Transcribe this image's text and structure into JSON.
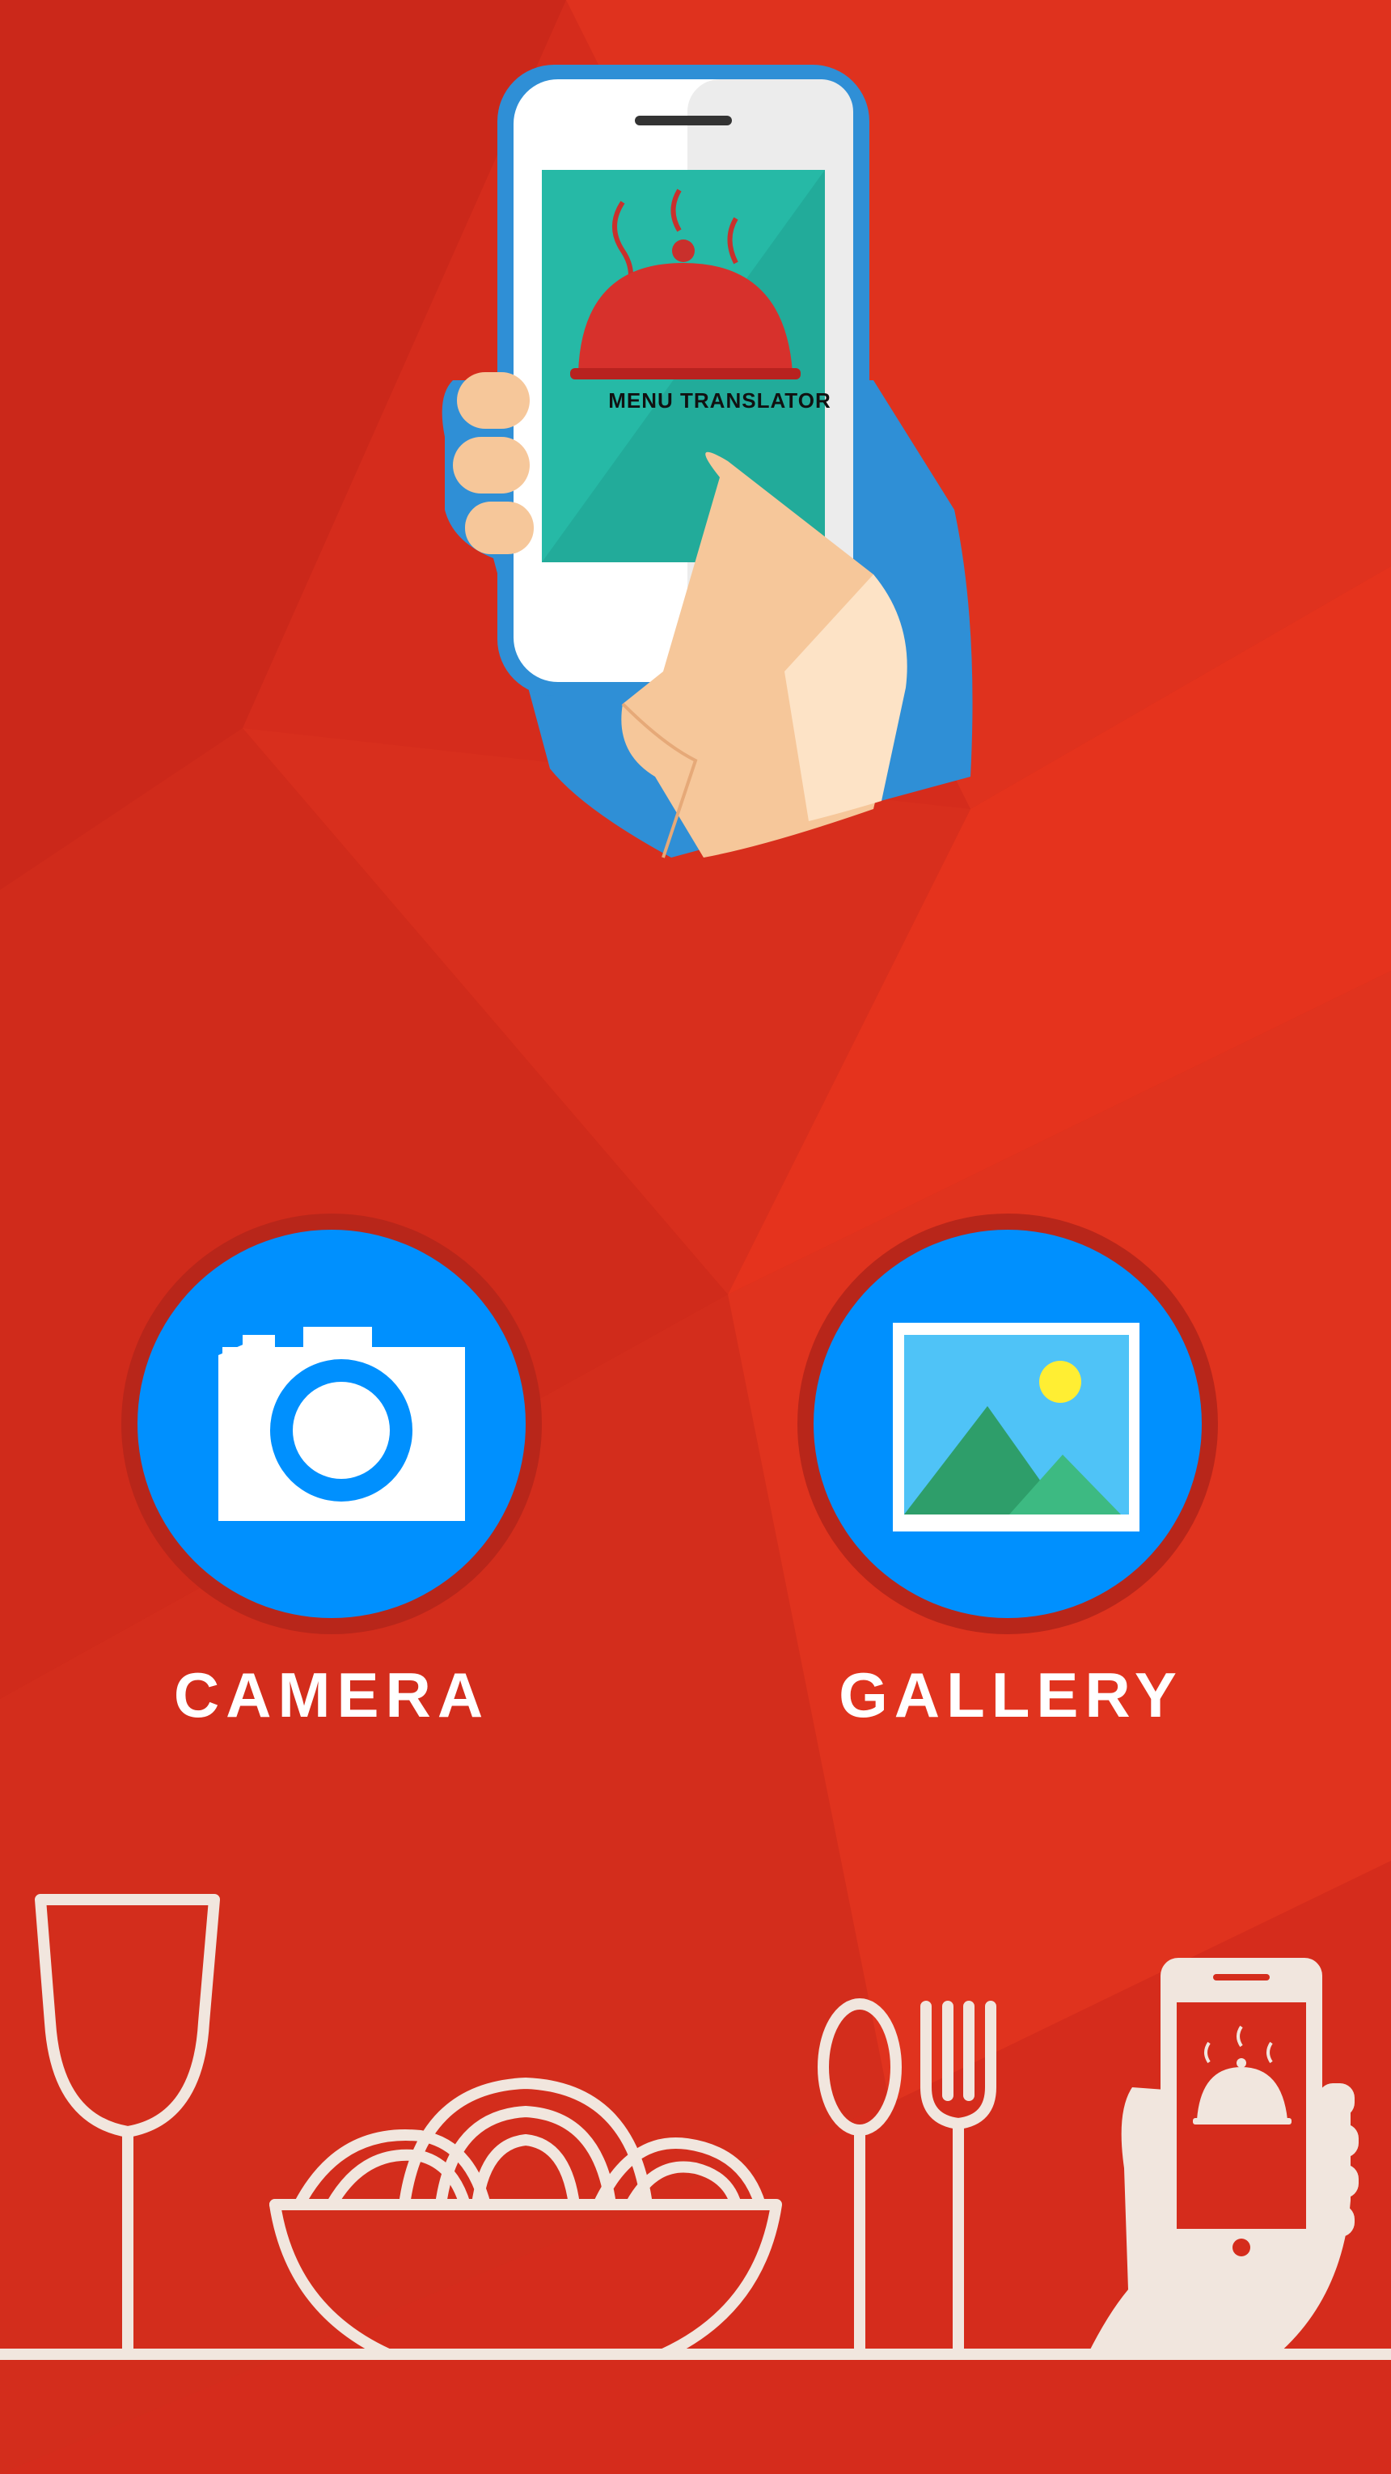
{
  "app": {
    "logo_text": "MENU TRANSLATOR"
  },
  "actions": {
    "camera_label": "CAMERA",
    "gallery_label": "GALLERY"
  },
  "icons": {
    "hero": "hand-holding-phone-icon",
    "camera": "camera-icon",
    "gallery": "image-gallery-icon",
    "footer": [
      "wine-glass-icon",
      "noodle-bowl-icon",
      "spoon-icon",
      "fork-icon",
      "hand-phone-icon"
    ]
  },
  "colors": {
    "background": "#d92e1e",
    "button_blue": "#0090fe",
    "button_ring": "#b8261a",
    "phone_screen": "#26b9a6",
    "cloche_red": "#d7312c",
    "footer_line": "#f1e6de"
  }
}
